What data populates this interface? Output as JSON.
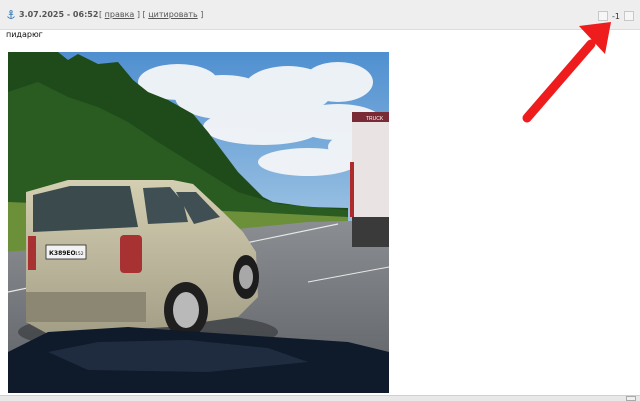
{
  "post": {
    "date": "3.07.2025 - 06:52",
    "actions": {
      "open_bracket": "[",
      "edit_label": "правка",
      "sep": "] [",
      "quote_label": "цитировать",
      "close_bracket": "]"
    },
    "vote": {
      "score": "-1"
    },
    "text": "пидарюг"
  },
  "photo": {
    "plate_text": "К389ЕО",
    "plate_region": "152",
    "truck_label": "TRUCK"
  },
  "colors": {
    "header_bg": "#eeeeee",
    "arrow": "#ee1c1c"
  }
}
